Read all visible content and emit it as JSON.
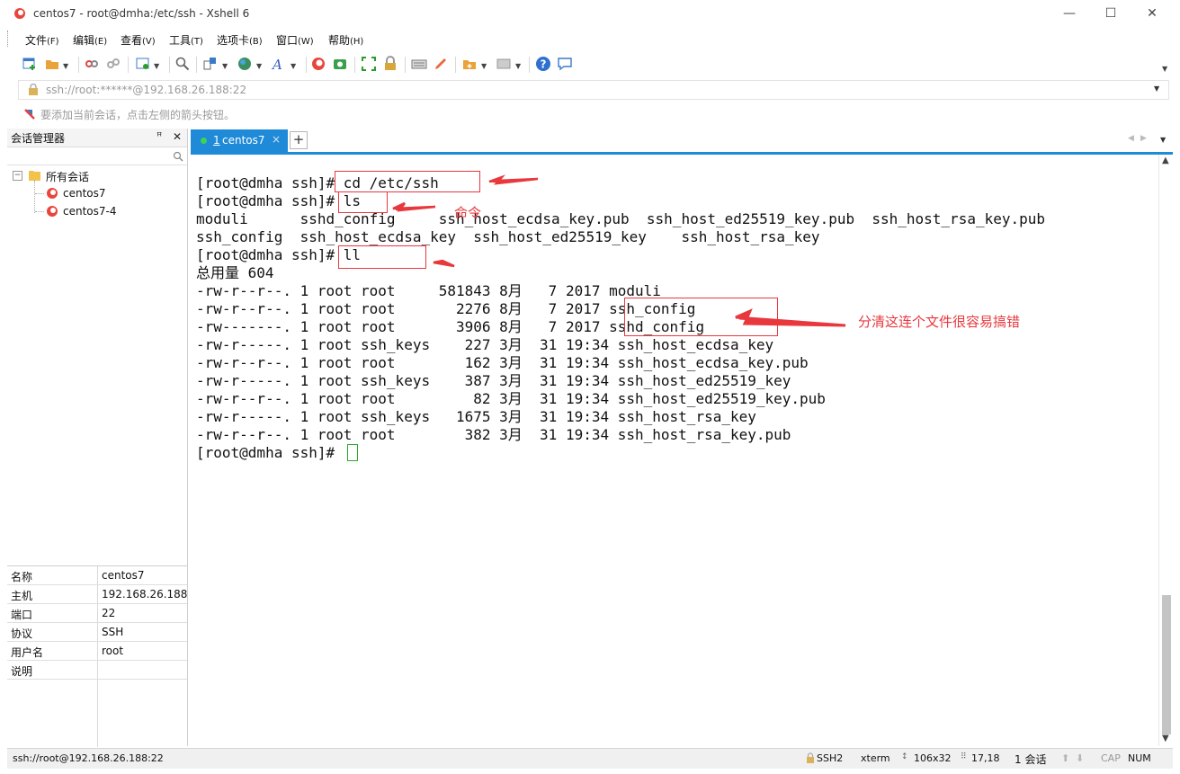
{
  "window": {
    "title": "centos7 - root@dmha:/etc/ssh - Xshell 6",
    "minimize_glyph": "—",
    "maximize_glyph": "☐",
    "close_glyph": "✕"
  },
  "menubar": [
    {
      "label": "文件",
      "accel": "(F)"
    },
    {
      "label": "编辑",
      "accel": "(E)"
    },
    {
      "label": "查看",
      "accel": "(V)"
    },
    {
      "label": "工具",
      "accel": "(T)"
    },
    {
      "label": "选项卡",
      "accel": "(B)"
    },
    {
      "label": "窗口",
      "accel": "(W)"
    },
    {
      "label": "帮助",
      "accel": "(H)"
    }
  ],
  "address_bar": {
    "value": "ssh://root:******@192.168.26.188:22"
  },
  "hint_bar": {
    "text": "要添加当前会话，点击左侧的箭头按钮。"
  },
  "session_manager": {
    "title": "会话管理器",
    "pin_glyph": "ꟸ",
    "close_glyph": "✕",
    "tree": {
      "root": "所有会话",
      "items": [
        "centos7",
        "centos7-4"
      ]
    },
    "properties": [
      {
        "key": "名称",
        "value": "centos7"
      },
      {
        "key": "主机",
        "value": "192.168.26.188"
      },
      {
        "key": "端口",
        "value": "22"
      },
      {
        "key": "协议",
        "value": "SSH"
      },
      {
        "key": "用户名",
        "value": "root"
      },
      {
        "key": "说明",
        "value": ""
      }
    ]
  },
  "tabs": [
    {
      "number": "1",
      "label": "centos7",
      "close_glyph": "×"
    }
  ],
  "tab_add_glyph": "+",
  "terminal": {
    "lines": [
      "[root@dmha ssh]# cd /etc/ssh",
      "[root@dmha ssh]# ls",
      "moduli      sshd_config     ssh_host_ecdsa_key.pub  ssh_host_ed25519_key.pub  ssh_host_rsa_key.pub",
      "ssh_config  ssh_host_ecdsa_key  ssh_host_ed25519_key    ssh_host_rsa_key",
      "[root@dmha ssh]# ll",
      "总用量 604",
      "-rw-r--r--. 1 root root     581843 8月   7 2017 moduli",
      "-rw-r--r--. 1 root root       2276 8月   7 2017 ssh_config",
      "-rw-------. 1 root root       3906 8月   7 2017 sshd_config",
      "-rw-r-----. 1 root ssh_keys    227 3月  31 19:34 ssh_host_ecdsa_key",
      "-rw-r--r--. 1 root root        162 3月  31 19:34 ssh_host_ecdsa_key.pub",
      "-rw-r-----. 1 root ssh_keys    387 3月  31 19:34 ssh_host_ed25519_key",
      "-rw-r--r--. 1 root root         82 3月  31 19:34 ssh_host_ed25519_key.pub",
      "-rw-r-----. 1 root ssh_keys   1675 3月  31 19:34 ssh_host_rsa_key",
      "-rw-r--r--. 1 root root        382 3月  31 19:34 ssh_host_rsa_key.pub",
      "[root@dmha ssh]# "
    ]
  },
  "annotations": {
    "command_label": "命令",
    "note": "分清这连个文件很容易搞错",
    "color": "#e8383d"
  },
  "status_bar": {
    "connection": "ssh://root@192.168.26.188:22",
    "protocol": "SSH2",
    "term": "xterm",
    "size": "106x32",
    "position": "17,18",
    "sessions": "1 会话",
    "caps": "CAP",
    "num": "NUM"
  }
}
